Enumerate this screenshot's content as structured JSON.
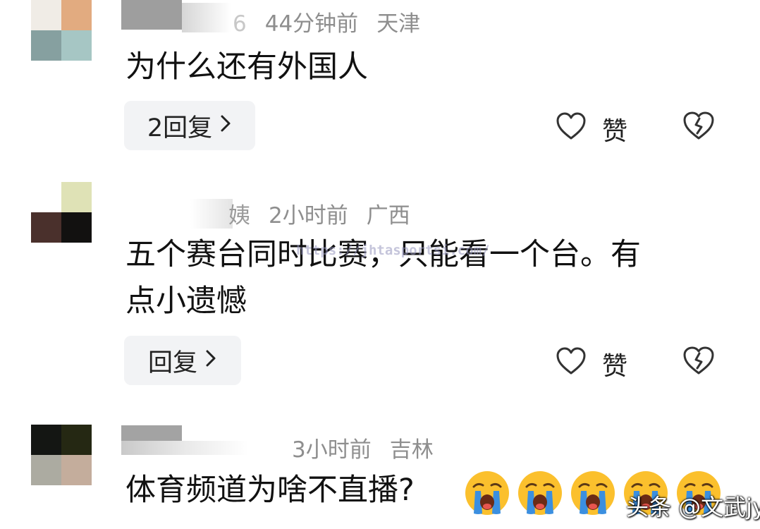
{
  "comments": [
    {
      "time": "44分钟前",
      "location": "天津",
      "name_fragment": "6",
      "text": "为什么还有外国人",
      "reply_label": "2回复",
      "like_label": "赞",
      "avatar_colors": [
        "#f0ece6",
        "#e2ab80",
        "#86a0a0",
        "#a6c6c4"
      ]
    },
    {
      "time": "2小时前",
      "location": "广西",
      "name_fragment": "姨",
      "text_line1": "五个赛台同时比赛，只能看一个台。有",
      "text_line2": "点小遗憾",
      "reply_label": "回复",
      "like_label": "赞",
      "avatar_colors": [
        "#ffffff",
        "#dfe2b6",
        "#4a302c",
        "#121110"
      ]
    },
    {
      "time": "3小时前",
      "location": "吉林",
      "text": "体育频道为啥不直播?",
      "avatar_colors": [
        "#141613",
        "#252813",
        "#acaba1",
        "#c4ad9c"
      ]
    }
  ],
  "url_watermark": "https://jhtasportsi.com/",
  "watermark": "头条 @文武jy",
  "colors": {
    "meta_gray": "#8e8e8e",
    "button_bg": "#f2f3f5",
    "emoji_yellow": "#fbc02d",
    "tears": "#3b8fe0"
  },
  "icons": [
    "heart-outline-icon",
    "broken-heart-icon",
    "chevron-right-icon",
    "crying-face-emoji"
  ]
}
